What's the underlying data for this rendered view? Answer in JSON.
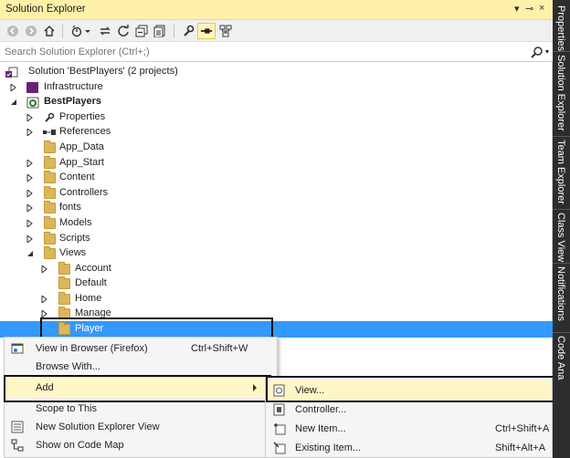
{
  "window": {
    "title": "Solution Explorer",
    "controls": [
      "▾",
      "‑ᵖ",
      "×"
    ]
  },
  "search": {
    "placeholder": "Search Solution Explorer (Ctrl+;)"
  },
  "tree": {
    "solution": "Solution 'BestPlayers' (2 projects)",
    "items": [
      {
        "label": "Infrastructure"
      },
      {
        "label": "BestPlayers"
      },
      {
        "label": "Properties"
      },
      {
        "label": "References"
      },
      {
        "label": "App_Data"
      },
      {
        "label": "App_Start"
      },
      {
        "label": "Content"
      },
      {
        "label": "Controllers"
      },
      {
        "label": "fonts"
      },
      {
        "label": "Models"
      },
      {
        "label": "Scripts"
      },
      {
        "label": "Views"
      },
      {
        "label": "Account"
      },
      {
        "label": "Default"
      },
      {
        "label": "Home"
      },
      {
        "label": "Manage"
      },
      {
        "label": "Player"
      }
    ]
  },
  "context_menu": {
    "items": [
      {
        "label": "View in Browser (Firefox)",
        "shortcut": "Ctrl+Shift+W"
      },
      {
        "label": "Browse With..."
      },
      {
        "label": "Add"
      },
      {
        "label": "Scope to This"
      },
      {
        "label": "New Solution Explorer View"
      },
      {
        "label": "Show on Code Map"
      }
    ]
  },
  "add_submenu": {
    "items": [
      {
        "label": "View..."
      },
      {
        "label": "Controller..."
      },
      {
        "label": "New Item...",
        "shortcut": "Ctrl+Shift+A"
      },
      {
        "label": "Existing Item...",
        "shortcut": "Shift+Alt+A"
      }
    ]
  },
  "side_tabs": [
    "Properties",
    "Solution Explorer",
    "Team Explorer",
    "Class View",
    "Notifications",
    "Code Ana"
  ],
  "colors": {
    "title_bar": "#fff1a8",
    "selection": "#3399ff",
    "folder": "#dcb65b",
    "side_panel": "#2d2d30"
  }
}
